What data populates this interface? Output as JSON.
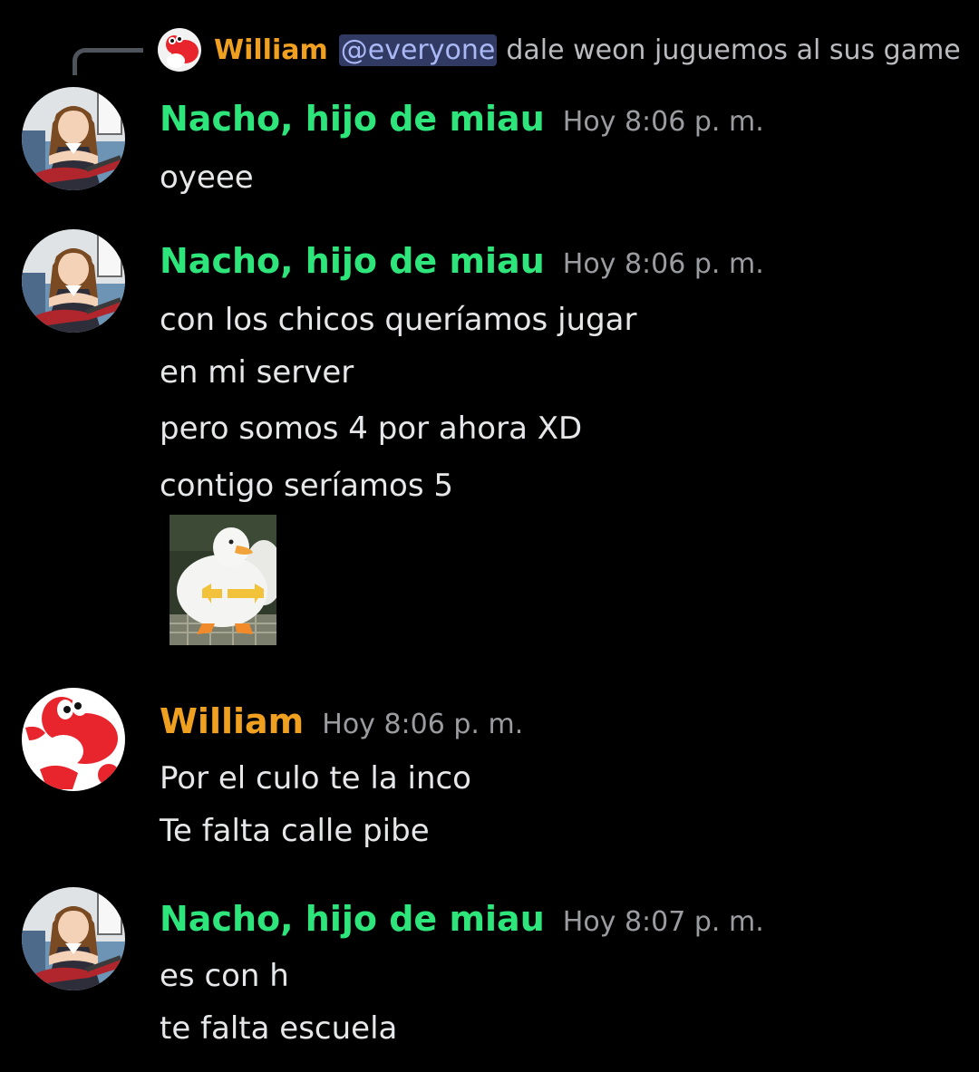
{
  "reply": {
    "author": "William",
    "mention": "@everyone",
    "text": "dale weon juguemos al sus game"
  },
  "messages": [
    {
      "author": "Nacho, hijo de miau",
      "time": "Hoy 8:06 p. m.",
      "lines": [
        "oyeee"
      ]
    },
    {
      "author": "Nacho, hijo de miau",
      "time": "Hoy 8:06 p. m.",
      "lines": [
        "con los chicos queríamos jugar",
        "en mi server",
        "pero somos 4 por ahora XD",
        "contigo seríamos 5"
      ]
    },
    {
      "author": "William",
      "time": "Hoy 8:06 p. m.",
      "lines": [
        "Por el culo te la inco",
        "Te falta calle pibe"
      ]
    },
    {
      "author": "Nacho, hijo de miau",
      "time": "Hoy 8:07 p. m.",
      "lines": [
        "es con h",
        "te falta escuela"
      ]
    }
  ],
  "colors": {
    "background": "#000000",
    "nacho_name": "#2ee57c",
    "william_name": "#f0a020",
    "mention_bg": "#313a63",
    "mention_text": "#aab8f5",
    "timestamp": "#9a9ca0"
  },
  "icons": {
    "nacho_avatar": "anime-girl-guitar-avatar",
    "william_avatar": "red-yoshi-avatar",
    "sticker": "duck-pointing-fingers-image"
  }
}
